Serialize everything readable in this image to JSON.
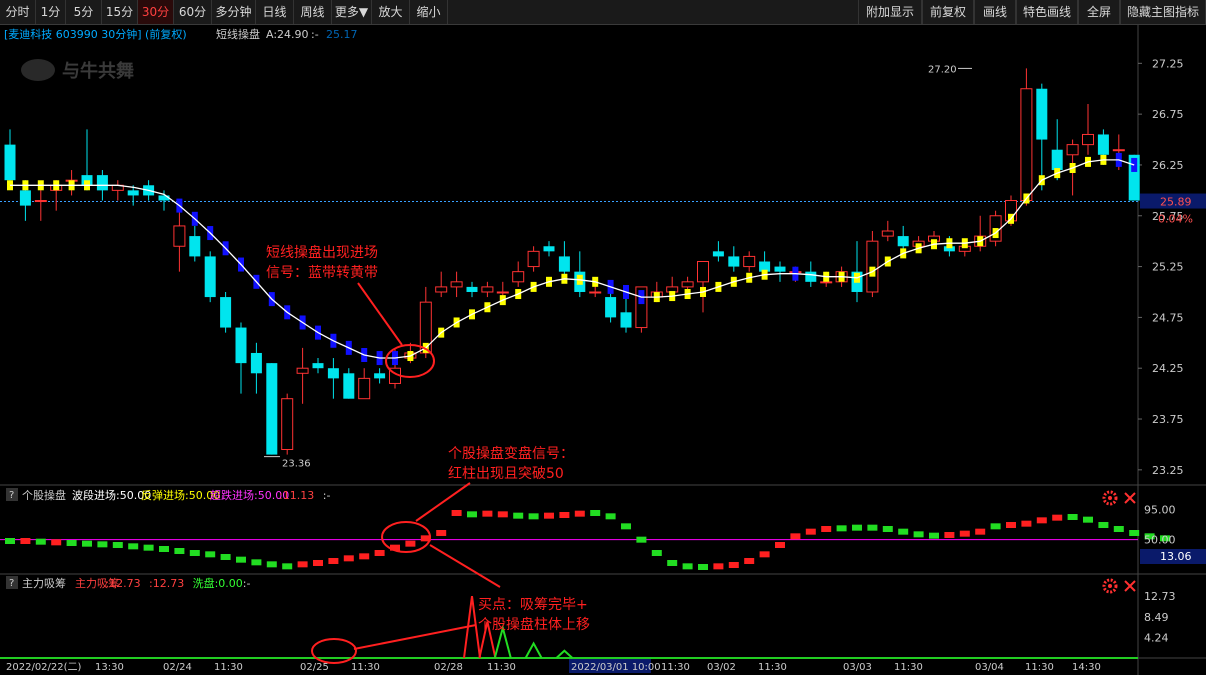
{
  "toolbar": {
    "left": [
      "分时",
      "1分",
      "5分",
      "15分",
      "30分",
      "60分",
      "多分钟",
      "日线",
      "周线",
      "更多▼",
      "放大",
      "缩小"
    ],
    "active": "30分",
    "right": [
      "附加显示",
      "前复权",
      "画线",
      "特色画线",
      "全屏",
      "隐藏主图指标"
    ]
  },
  "main_header": {
    "stock": "[麦迪科技 603990 30分钟] (前复权)",
    "indicator": "短线操盘",
    "a_label": "A:24.90",
    "a_dash": ":-",
    "watermark_value": "25.17"
  },
  "logo_text": "与牛共舞",
  "sub1_header": {
    "q": "?",
    "name": "个股操盘",
    "parts": [
      "波段进场:50.00",
      "反弹进场:50.00",
      "超跌进场:50.00",
      ":11.13",
      ":-"
    ],
    "colors": [
      "#ffffff",
      "#ffff00",
      "#ff33ff",
      "#ff4040",
      "#cccccc"
    ]
  },
  "sub2_header": {
    "q": "?",
    "name": "主力吸筹",
    "parts": [
      "主力吸筹",
      ":12.73",
      ":12.73",
      "洗盘:0.00",
      ":-"
    ],
    "colors": [
      "#ff4040",
      "#ff4040",
      "#ff4040",
      "#33ff33",
      "#cccccc"
    ]
  },
  "annotations": {
    "a1": [
      "短线操盘出现进场",
      "信号：蓝带转黄带"
    ],
    "a2": [
      "个股操盘变盘信号：",
      "红柱出现且突破50"
    ],
    "a3": [
      "买点：吸筹完毕+",
      "个股操盘柱体上移"
    ]
  },
  "price_marks": {
    "high": "27.20",
    "low": "23.36",
    "current": "25.89",
    "current_pct": "0.04%"
  },
  "sub1_labels": {
    "top": "95.00",
    "mid": "50.00",
    "current": "13.06"
  },
  "sub2_labels": [
    "12.73",
    "8.49",
    "4.24"
  ],
  "colors": {
    "up": "#ff3333",
    "down": "#00e5ee",
    "blue": "#1010ff",
    "yellow": "#ffff00",
    "green": "#22dd22",
    "magenta": "#ff00ff"
  },
  "chart_data": [
    {
      "type": "candlestick",
      "title": "短线操盘",
      "y_ticks": [
        27.25,
        26.75,
        26.25,
        25.75,
        25.25,
        24.75,
        24.25,
        23.75,
        23.25
      ],
      "ylim": [
        23.15,
        27.45
      ],
      "x_labels": [
        "2022/02/22(二)",
        "13:30",
        "02/24",
        "11:30",
        "02/25",
        "11:30",
        "02/28",
        "11:30",
        "2022/03/01 10:00",
        "11:30",
        "03/02",
        "11:30",
        "03/03",
        "11:30",
        "03/04",
        "11:30",
        "14:30"
      ],
      "candles": [
        [
          26.45,
          26.6,
          26.05,
          26.1
        ],
        [
          26.0,
          26.1,
          25.7,
          25.85
        ],
        [
          25.9,
          26.05,
          25.7,
          25.9
        ],
        [
          26.0,
          26.1,
          25.8,
          26.05
        ],
        [
          26.1,
          26.2,
          25.95,
          26.1
        ],
        [
          26.15,
          26.6,
          26.0,
          26.05
        ],
        [
          26.15,
          26.2,
          25.9,
          26.0
        ],
        [
          26.0,
          26.1,
          25.9,
          26.05
        ],
        [
          26.0,
          26.05,
          25.85,
          25.95
        ],
        [
          26.05,
          26.1,
          25.9,
          25.95
        ],
        [
          25.95,
          26.0,
          25.8,
          25.9
        ],
        [
          25.45,
          25.85,
          25.2,
          25.65
        ],
        [
          25.55,
          25.65,
          25.3,
          25.35
        ],
        [
          25.35,
          25.4,
          24.9,
          24.95
        ],
        [
          24.95,
          25.0,
          24.6,
          24.65
        ],
        [
          24.65,
          24.7,
          24.0,
          24.3
        ],
        [
          24.4,
          24.5,
          24.0,
          24.2
        ],
        [
          24.3,
          24.3,
          23.4,
          23.4
        ],
        [
          23.45,
          24.0,
          23.4,
          23.95
        ],
        [
          24.2,
          24.45,
          23.9,
          24.25
        ],
        [
          24.3,
          24.35,
          24.2,
          24.25
        ],
        [
          24.25,
          24.35,
          23.95,
          24.15
        ],
        [
          24.2,
          24.25,
          23.95,
          23.95
        ],
        [
          23.95,
          24.25,
          23.95,
          24.15
        ],
        [
          24.2,
          24.25,
          24.1,
          24.15
        ],
        [
          24.1,
          24.45,
          24.05,
          24.25
        ],
        [
          24.35,
          24.5,
          24.3,
          24.4
        ],
        [
          24.4,
          25.05,
          24.35,
          24.9
        ],
        [
          25.0,
          25.2,
          24.95,
          25.05
        ],
        [
          25.05,
          25.2,
          24.95,
          25.1
        ],
        [
          25.05,
          25.1,
          24.95,
          25.0
        ],
        [
          25.0,
          25.1,
          24.95,
          25.05
        ],
        [
          25.0,
          25.1,
          24.95,
          25.0
        ],
        [
          25.1,
          25.3,
          25.05,
          25.2
        ],
        [
          25.25,
          25.45,
          25.2,
          25.4
        ],
        [
          25.45,
          25.5,
          25.35,
          25.4
        ],
        [
          25.35,
          25.5,
          25.1,
          25.2
        ],
        [
          25.2,
          25.4,
          24.95,
          25.0
        ],
        [
          25.0,
          25.1,
          24.95,
          25.0
        ],
        [
          24.95,
          25.05,
          24.7,
          24.75
        ],
        [
          24.8,
          24.95,
          24.6,
          24.65
        ],
        [
          24.65,
          25.05,
          24.6,
          25.05
        ],
        [
          24.95,
          25.1,
          24.9,
          25.0
        ],
        [
          25.0,
          25.15,
          24.95,
          25.05
        ],
        [
          25.05,
          25.15,
          24.95,
          25.1
        ],
        [
          25.1,
          25.3,
          24.8,
          25.3
        ],
        [
          25.4,
          25.5,
          25.3,
          25.35
        ],
        [
          25.35,
          25.45,
          25.2,
          25.25
        ],
        [
          25.25,
          25.4,
          25.2,
          25.35
        ],
        [
          25.3,
          25.4,
          25.15,
          25.2
        ],
        [
          25.25,
          25.3,
          25.1,
          25.2
        ],
        [
          25.2,
          25.25,
          25.1,
          25.2
        ],
        [
          25.2,
          25.3,
          25.05,
          25.1
        ],
        [
          25.1,
          25.2,
          25.05,
          25.1
        ],
        [
          25.1,
          25.25,
          25.05,
          25.2
        ],
        [
          25.2,
          25.5,
          24.9,
          25.0
        ],
        [
          25.0,
          25.6,
          24.95,
          25.5
        ],
        [
          25.55,
          25.7,
          25.5,
          25.6
        ],
        [
          25.55,
          25.65,
          25.4,
          25.45
        ],
        [
          25.45,
          25.55,
          25.4,
          25.5
        ],
        [
          25.5,
          25.6,
          25.45,
          25.55
        ],
        [
          25.45,
          25.55,
          25.35,
          25.4
        ],
        [
          25.4,
          25.5,
          25.35,
          25.45
        ],
        [
          25.45,
          25.75,
          25.4,
          25.55
        ],
        [
          25.5,
          25.8,
          25.45,
          25.75
        ],
        [
          25.7,
          25.95,
          25.65,
          25.9
        ],
        [
          25.9,
          27.2,
          25.85,
          27.0
        ],
        [
          27.0,
          27.05,
          26.0,
          26.5
        ],
        [
          26.4,
          26.7,
          26.1,
          26.2
        ],
        [
          26.35,
          26.5,
          25.95,
          26.45
        ],
        [
          26.45,
          26.85,
          26.35,
          26.55
        ],
        [
          26.55,
          26.6,
          26.25,
          26.35
        ],
        [
          26.4,
          26.55,
          26.2,
          26.4
        ],
        [
          26.35,
          26.35,
          25.9,
          25.9
        ]
      ],
      "ma_line": [
        26.05,
        26.05,
        26.05,
        26.05,
        26.05,
        26.05,
        26.05,
        26.05,
        26.03,
        26.0,
        25.96,
        25.85,
        25.72,
        25.58,
        25.43,
        25.27,
        25.1,
        24.93,
        24.8,
        24.7,
        24.6,
        24.52,
        24.45,
        24.38,
        24.35,
        24.35,
        24.37,
        24.45,
        24.6,
        24.7,
        24.78,
        24.85,
        24.92,
        24.98,
        25.05,
        25.1,
        25.13,
        25.12,
        25.1,
        25.05,
        25.0,
        24.95,
        24.95,
        24.96,
        24.98,
        25.0,
        25.05,
        25.1,
        25.14,
        25.17,
        25.18,
        25.18,
        25.17,
        25.15,
        25.15,
        25.14,
        25.2,
        25.3,
        25.38,
        25.43,
        25.47,
        25.48,
        25.48,
        25.5,
        25.58,
        25.72,
        25.92,
        26.1,
        26.17,
        26.22,
        26.28,
        26.3,
        26.3,
        26.25
      ],
      "band": [
        "Y",
        "Y",
        "Y",
        "Y",
        "Y",
        "Y",
        "W",
        "W",
        "W",
        "W",
        "W",
        "B",
        "B",
        "B",
        "B",
        "B",
        "B",
        "B",
        "B",
        "B",
        "B",
        "B",
        "B",
        "B",
        "B",
        "B",
        "Y",
        "Y",
        "Y",
        "Y",
        "Y",
        "Y",
        "Y",
        "Y",
        "Y",
        "Y",
        "Y",
        "Y",
        "Y",
        "B",
        "B",
        "B",
        "Y",
        "Y",
        "Y",
        "Y",
        "Y",
        "Y",
        "Y",
        "Y",
        "W",
        "B",
        "W",
        "Y",
        "Y",
        "Y",
        "Y",
        "Y",
        "Y",
        "Y",
        "Y",
        "Y",
        "Y",
        "Y",
        "Y",
        "Y",
        "Y",
        "Y",
        "Y",
        "Y",
        "Y",
        "Y",
        "B",
        "B"
      ]
    },
    {
      "type": "bar",
      "title": "个股操盘",
      "y_ticks": [
        95.0,
        50.0
      ],
      "ylim": [
        0,
        105
      ],
      "reference_line": 50,
      "values": [
        48,
        48,
        47,
        46,
        45,
        44,
        43,
        42,
        40,
        38,
        36,
        33,
        30,
        28,
        24,
        20,
        16,
        13,
        10,
        13,
        15,
        18,
        22,
        25,
        30,
        38,
        44,
        52,
        60,
        90,
        88,
        89,
        88,
        86,
        85,
        86,
        87,
        89,
        90,
        85,
        70,
        50,
        30,
        15,
        10,
        9,
        10,
        12,
        18,
        28,
        42,
        55,
        62,
        66,
        67,
        68,
        68,
        66,
        62,
        58,
        56,
        57,
        59,
        62,
        70,
        72,
        74,
        79,
        83,
        84,
        80,
        72,
        66,
        60,
        55,
        52
      ],
      "up": [
        false,
        true,
        false,
        true,
        false,
        false,
        false,
        false,
        false,
        false,
        false,
        false,
        false,
        false,
        false,
        false,
        false,
        false,
        false,
        true,
        true,
        true,
        true,
        true,
        true,
        true,
        true,
        true,
        true,
        true,
        false,
        true,
        true,
        false,
        false,
        true,
        true,
        true,
        false,
        false,
        false,
        false,
        false,
        false,
        false,
        false,
        true,
        true,
        true,
        true,
        true,
        true,
        true,
        true,
        false,
        false,
        false,
        false,
        false,
        false,
        false,
        true,
        true,
        true,
        false,
        true,
        true,
        true,
        true,
        false,
        false,
        false,
        false,
        false,
        false,
        false
      ],
      "current": 13.06
    },
    {
      "type": "bar",
      "title": "主力吸筹",
      "y_ticks": [
        12.73,
        8.49,
        4.24
      ],
      "ylim": [
        0,
        14
      ],
      "spikes": [
        {
          "i": 30,
          "value": 12.73,
          "color": "red"
        },
        {
          "i": 31,
          "value": 7.5,
          "color": "red"
        },
        {
          "i": 32,
          "value": 6.2,
          "color": "green"
        },
        {
          "i": 34,
          "value": 3.0,
          "color": "green"
        },
        {
          "i": 36,
          "value": 1.5,
          "color": "green"
        }
      ]
    }
  ]
}
